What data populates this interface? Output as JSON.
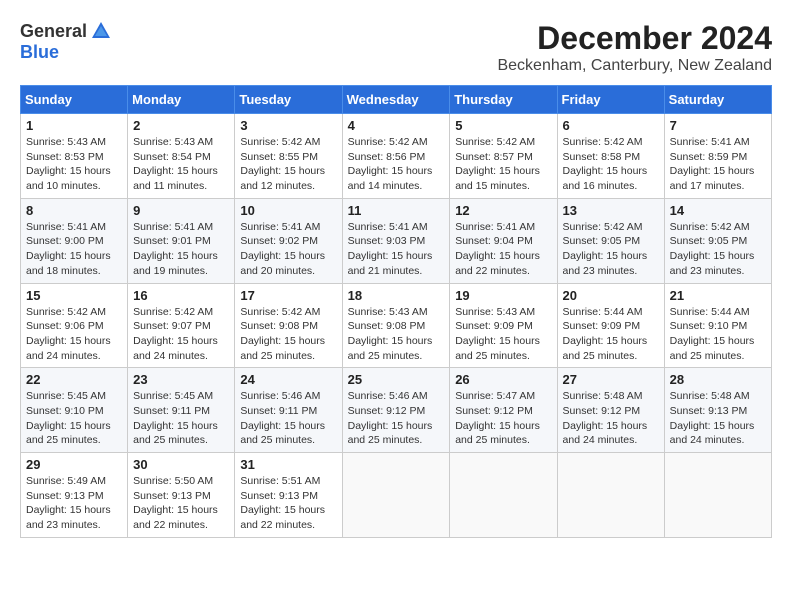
{
  "logo": {
    "general": "General",
    "blue": "Blue"
  },
  "title": "December 2024",
  "location": "Beckenham, Canterbury, New Zealand",
  "days_of_week": [
    "Sunday",
    "Monday",
    "Tuesday",
    "Wednesday",
    "Thursday",
    "Friday",
    "Saturday"
  ],
  "weeks": [
    [
      {
        "day": "1",
        "info": "Sunrise: 5:43 AM\nSunset: 8:53 PM\nDaylight: 15 hours\nand 10 minutes."
      },
      {
        "day": "2",
        "info": "Sunrise: 5:43 AM\nSunset: 8:54 PM\nDaylight: 15 hours\nand 11 minutes."
      },
      {
        "day": "3",
        "info": "Sunrise: 5:42 AM\nSunset: 8:55 PM\nDaylight: 15 hours\nand 12 minutes."
      },
      {
        "day": "4",
        "info": "Sunrise: 5:42 AM\nSunset: 8:56 PM\nDaylight: 15 hours\nand 14 minutes."
      },
      {
        "day": "5",
        "info": "Sunrise: 5:42 AM\nSunset: 8:57 PM\nDaylight: 15 hours\nand 15 minutes."
      },
      {
        "day": "6",
        "info": "Sunrise: 5:42 AM\nSunset: 8:58 PM\nDaylight: 15 hours\nand 16 minutes."
      },
      {
        "day": "7",
        "info": "Sunrise: 5:41 AM\nSunset: 8:59 PM\nDaylight: 15 hours\nand 17 minutes."
      }
    ],
    [
      {
        "day": "8",
        "info": "Sunrise: 5:41 AM\nSunset: 9:00 PM\nDaylight: 15 hours\nand 18 minutes."
      },
      {
        "day": "9",
        "info": "Sunrise: 5:41 AM\nSunset: 9:01 PM\nDaylight: 15 hours\nand 19 minutes."
      },
      {
        "day": "10",
        "info": "Sunrise: 5:41 AM\nSunset: 9:02 PM\nDaylight: 15 hours\nand 20 minutes."
      },
      {
        "day": "11",
        "info": "Sunrise: 5:41 AM\nSunset: 9:03 PM\nDaylight: 15 hours\nand 21 minutes."
      },
      {
        "day": "12",
        "info": "Sunrise: 5:41 AM\nSunset: 9:04 PM\nDaylight: 15 hours\nand 22 minutes."
      },
      {
        "day": "13",
        "info": "Sunrise: 5:42 AM\nSunset: 9:05 PM\nDaylight: 15 hours\nand 23 minutes."
      },
      {
        "day": "14",
        "info": "Sunrise: 5:42 AM\nSunset: 9:05 PM\nDaylight: 15 hours\nand 23 minutes."
      }
    ],
    [
      {
        "day": "15",
        "info": "Sunrise: 5:42 AM\nSunset: 9:06 PM\nDaylight: 15 hours\nand 24 minutes."
      },
      {
        "day": "16",
        "info": "Sunrise: 5:42 AM\nSunset: 9:07 PM\nDaylight: 15 hours\nand 24 minutes."
      },
      {
        "day": "17",
        "info": "Sunrise: 5:42 AM\nSunset: 9:08 PM\nDaylight: 15 hours\nand 25 minutes."
      },
      {
        "day": "18",
        "info": "Sunrise: 5:43 AM\nSunset: 9:08 PM\nDaylight: 15 hours\nand 25 minutes."
      },
      {
        "day": "19",
        "info": "Sunrise: 5:43 AM\nSunset: 9:09 PM\nDaylight: 15 hours\nand 25 minutes."
      },
      {
        "day": "20",
        "info": "Sunrise: 5:44 AM\nSunset: 9:09 PM\nDaylight: 15 hours\nand 25 minutes."
      },
      {
        "day": "21",
        "info": "Sunrise: 5:44 AM\nSunset: 9:10 PM\nDaylight: 15 hours\nand 25 minutes."
      }
    ],
    [
      {
        "day": "22",
        "info": "Sunrise: 5:45 AM\nSunset: 9:10 PM\nDaylight: 15 hours\nand 25 minutes."
      },
      {
        "day": "23",
        "info": "Sunrise: 5:45 AM\nSunset: 9:11 PM\nDaylight: 15 hours\nand 25 minutes."
      },
      {
        "day": "24",
        "info": "Sunrise: 5:46 AM\nSunset: 9:11 PM\nDaylight: 15 hours\nand 25 minutes."
      },
      {
        "day": "25",
        "info": "Sunrise: 5:46 AM\nSunset: 9:12 PM\nDaylight: 15 hours\nand 25 minutes."
      },
      {
        "day": "26",
        "info": "Sunrise: 5:47 AM\nSunset: 9:12 PM\nDaylight: 15 hours\nand 25 minutes."
      },
      {
        "day": "27",
        "info": "Sunrise: 5:48 AM\nSunset: 9:12 PM\nDaylight: 15 hours\nand 24 minutes."
      },
      {
        "day": "28",
        "info": "Sunrise: 5:48 AM\nSunset: 9:13 PM\nDaylight: 15 hours\nand 24 minutes."
      }
    ],
    [
      {
        "day": "29",
        "info": "Sunrise: 5:49 AM\nSunset: 9:13 PM\nDaylight: 15 hours\nand 23 minutes."
      },
      {
        "day": "30",
        "info": "Sunrise: 5:50 AM\nSunset: 9:13 PM\nDaylight: 15 hours\nand 22 minutes."
      },
      {
        "day": "31",
        "info": "Sunrise: 5:51 AM\nSunset: 9:13 PM\nDaylight: 15 hours\nand 22 minutes."
      },
      {
        "day": "",
        "info": ""
      },
      {
        "day": "",
        "info": ""
      },
      {
        "day": "",
        "info": ""
      },
      {
        "day": "",
        "info": ""
      }
    ]
  ]
}
